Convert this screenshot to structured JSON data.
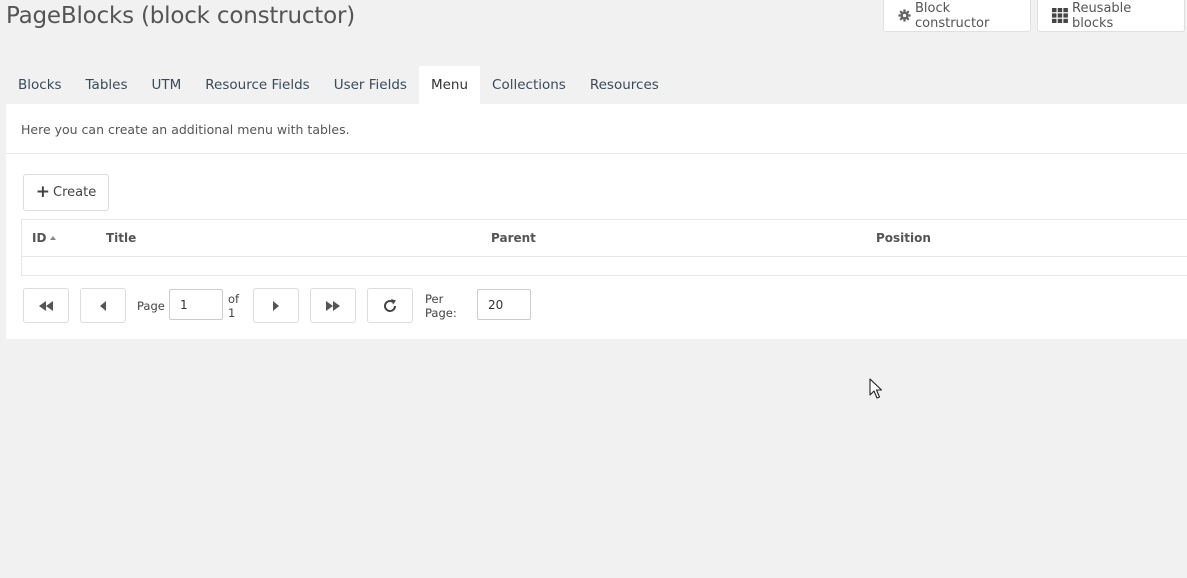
{
  "page": {
    "title": "PageBlocks (block constructor)"
  },
  "header_buttons": {
    "block_constructor": {
      "label": "Block constructor",
      "icon": "gear-icon"
    },
    "reusable_blocks": {
      "label": "Reusable blocks",
      "icon": "grid-icon"
    }
  },
  "tabs": [
    {
      "label": "Blocks"
    },
    {
      "label": "Tables"
    },
    {
      "label": "UTM"
    },
    {
      "label": "Resource Fields"
    },
    {
      "label": "User Fields"
    },
    {
      "label": "Menu",
      "active": true
    },
    {
      "label": "Collections"
    },
    {
      "label": "Resources"
    }
  ],
  "panel": {
    "intro": "Here you can create an additional menu with tables.",
    "create_label": "Create",
    "columns": [
      {
        "label": "ID",
        "sorted": "asc"
      },
      {
        "label": "Title"
      },
      {
        "label": "Parent"
      },
      {
        "label": "Position"
      }
    ],
    "rows": []
  },
  "pager": {
    "page_label": "Page",
    "current_page": "1",
    "of_label": "of 1",
    "per_page_label": "Per Page:",
    "per_page_value": "20"
  },
  "colors": {
    "background": "#f0f1f0",
    "panel": "#ffffff",
    "tab_text": "#3b4a5a"
  }
}
